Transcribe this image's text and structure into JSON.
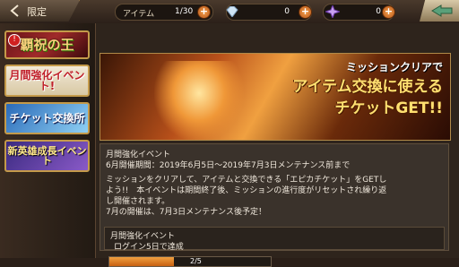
{
  "header": {
    "back_label": "限定",
    "items_label": "アイテム",
    "items_count": "1/30",
    "crystal_value": "0",
    "gem_value": "0"
  },
  "sidebar": {
    "banners": [
      {
        "label": "覇祝の王",
        "badge": "!"
      },
      {
        "label": "月間強化イベント!"
      },
      {
        "label": "チケット交換所"
      },
      {
        "label": "新英雄成長イベント"
      }
    ]
  },
  "hero": {
    "line1": "ミッションクリアで",
    "line2": "アイテム交換に使える",
    "line3": "チケットGET!!"
  },
  "info": {
    "title": "月間強化イベント",
    "period": "6月開催期間：2019年6月5日〜2019年7月3日メンテナンス前まで",
    "body1": "ミッションをクリアして、アイテムと交換できる「エピカチケット」をGETし",
    "body2": "よう!!　本イベントは期間終了後、ミッションの進行度がリセットされ繰り返",
    "body3": "し開催されます。",
    "body4": "7月の開催は、7月3日メンテナンス後予定！"
  },
  "mission": {
    "title": "月間強化イベント",
    "task": "ログイン5日で達成",
    "progress_text": "2/5",
    "progress": 0.4
  },
  "colors": {
    "accent": "#f0a040",
    "gold": "#ffe070"
  }
}
